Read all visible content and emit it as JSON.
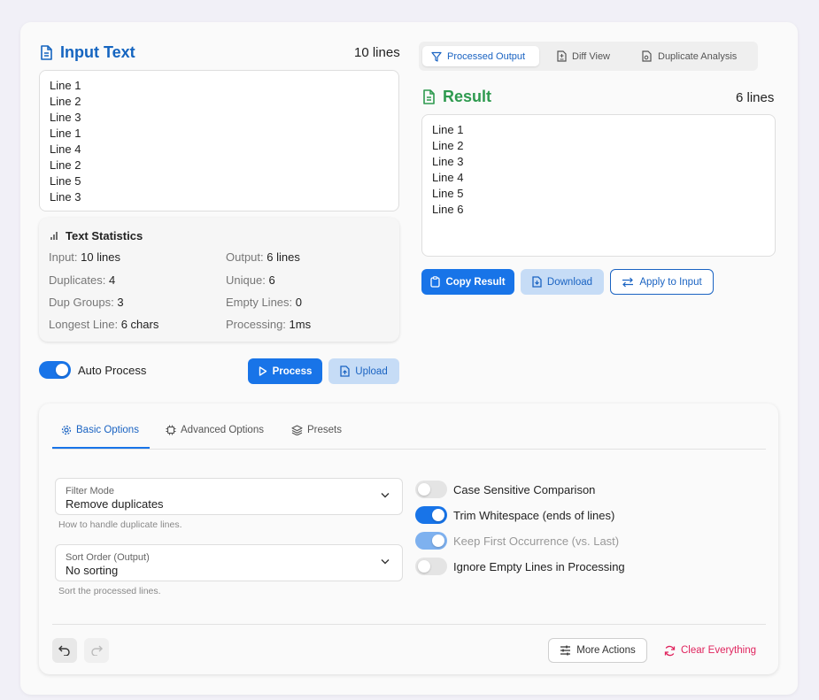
{
  "input": {
    "title": "Input Text",
    "line_count": "10 lines",
    "lines": [
      "Line 1",
      "Line 2",
      "Line 3",
      "Line 1",
      "Line 4",
      "Line 2",
      "Line 5",
      "Line 3"
    ]
  },
  "stats": {
    "title": "Text Statistics",
    "input_label": "Input:",
    "input_value": "10 lines",
    "output_label": "Output:",
    "output_value": "6 lines",
    "duplicates_label": "Duplicates:",
    "duplicates_value": "4",
    "unique_label": "Unique:",
    "unique_value": "6",
    "dup_groups_label": "Dup Groups:",
    "dup_groups_value": "3",
    "empty_label": "Empty Lines:",
    "empty_value": "0",
    "longest_label": "Longest Line:",
    "longest_value": "6 chars",
    "processing_label": "Processing:",
    "processing_value": "1ms"
  },
  "controls": {
    "auto_process_label": "Auto Process",
    "auto_process_on": true,
    "process_label": "Process",
    "upload_label": "Upload"
  },
  "output_tabs": {
    "processed": "Processed Output",
    "diff": "Diff View",
    "duplicate": "Duplicate Analysis"
  },
  "result": {
    "title": "Result",
    "line_count": "6 lines",
    "lines": [
      "Line 1",
      "Line 2",
      "Line 3",
      "Line 4",
      "Line 5",
      "Line 6"
    ],
    "copy_label": "Copy Result",
    "download_label": "Download",
    "apply_label": "Apply to Input"
  },
  "options": {
    "tabs": {
      "basic": "Basic Options",
      "advanced": "Advanced Options",
      "presets": "Presets"
    },
    "filter_mode": {
      "label": "Filter Mode",
      "value": "Remove duplicates",
      "helper": "How to handle duplicate lines."
    },
    "sort_order": {
      "label": "Sort Order (Output)",
      "value": "No sorting",
      "helper": "Sort the processed lines."
    },
    "toggles": {
      "case_sensitive": "Case Sensitive Comparison",
      "trim_whitespace": "Trim Whitespace (ends of lines)",
      "keep_first": "Keep First Occurrence (vs. Last)",
      "ignore_empty": "Ignore Empty Lines in Processing"
    },
    "more_actions_label": "More Actions",
    "clear_label": "Clear Everything"
  },
  "colors": {
    "accent": "#1874e8",
    "result_green": "#2e9a4f",
    "clear_red": "#e0245e"
  }
}
